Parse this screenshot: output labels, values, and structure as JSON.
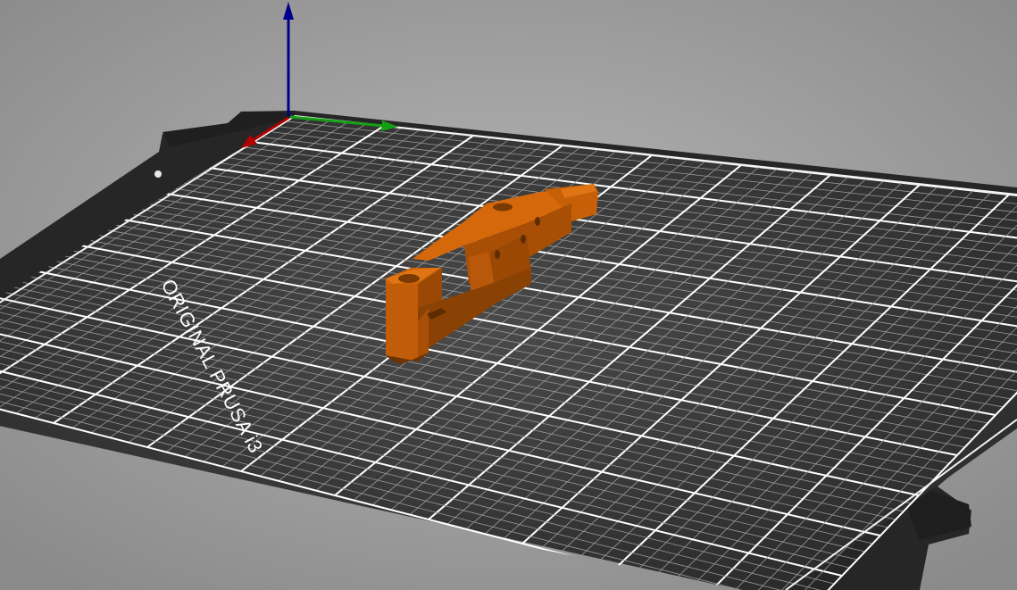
{
  "viewport": {
    "background_top": "#a9a9a9",
    "background_bottom": "#6f6f6f"
  },
  "bed": {
    "label": "ORIGINAL PRUSA i3",
    "plate_color": "#2b2b2b",
    "grid_color": "#d9d9d9",
    "major_grid_color": "#ffffff",
    "frame_color": "#242424"
  },
  "model": {
    "color": "#d4680a",
    "shade_color": "#a84f05",
    "dark_color": "#7a3a03"
  },
  "axes": {
    "x_color": "#b30000",
    "y_color": "#14a014",
    "z_color": "#00008c"
  }
}
